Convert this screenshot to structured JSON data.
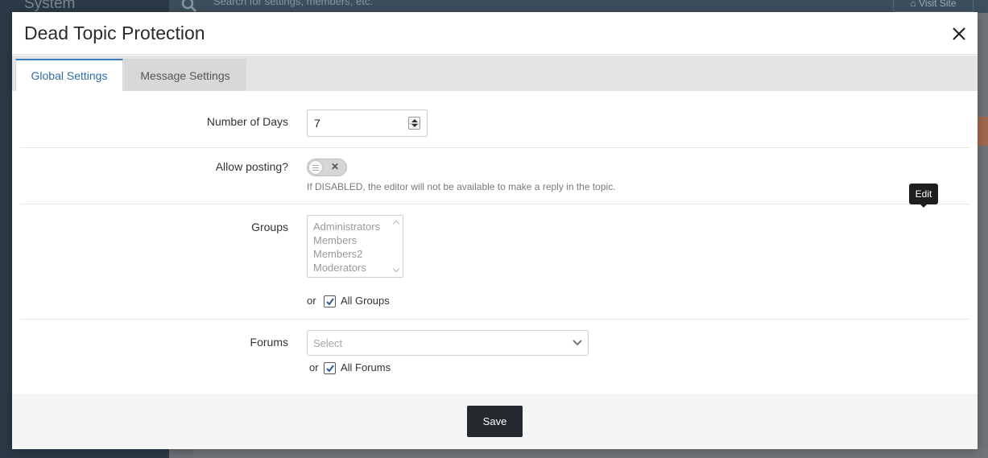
{
  "background": {
    "brand": "System",
    "search_placeholder": "Search for settings, members, etc.",
    "visit_site": "Visit Site"
  },
  "modal": {
    "title": "Dead Topic Protection",
    "tabs": [
      {
        "label": "Global Settings",
        "active": true
      },
      {
        "label": "Message Settings",
        "active": false
      }
    ],
    "fields": {
      "days": {
        "label": "Number of Days",
        "value": "7"
      },
      "posting": {
        "label": "Allow posting?",
        "enabled": false,
        "help": "If DISABLED, the editor will not be available to make a reply in the topic."
      },
      "groups": {
        "label": "Groups",
        "options": [
          "Administrators",
          "Members",
          "Members2",
          "Moderators"
        ],
        "or": "or",
        "all_label": "All Groups",
        "all_checked": true
      },
      "forums": {
        "label": "Forums",
        "placeholder": "Select",
        "or": "or",
        "all_label": "All Forums",
        "all_checked": true
      }
    },
    "save_label": "Save"
  },
  "tooltip": {
    "text": "Edit"
  },
  "colors": {
    "accent": "#3d7cc0",
    "save_button": "#24292d"
  }
}
